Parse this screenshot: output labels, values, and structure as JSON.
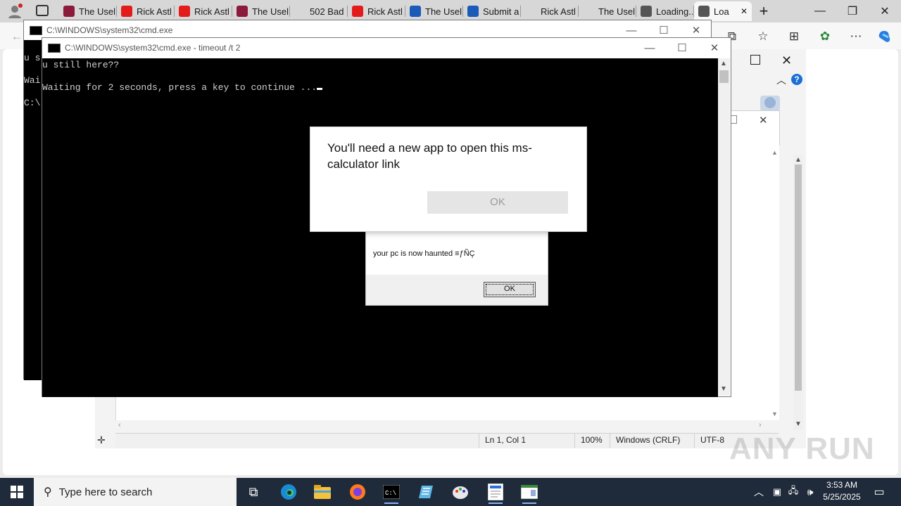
{
  "browser": {
    "tabs": [
      {
        "label": "The Usel",
        "fav": "#8b1a3b"
      },
      {
        "label": "Rick Astl",
        "fav": "#e41b1b"
      },
      {
        "label": "Rick Astl",
        "fav": "#e41b1b"
      },
      {
        "label": "The Usel",
        "fav": "#8b1a3b"
      },
      {
        "label": "502 Bad",
        "fav": "none"
      },
      {
        "label": "Rick Astl",
        "fav": "#e41b1b"
      },
      {
        "label": "The Usel",
        "fav": "#1a5ab8"
      },
      {
        "label": "Submit a",
        "fav": "#1a5ab8"
      },
      {
        "label": "Rick Astl",
        "fav": "none"
      },
      {
        "label": "The Usel",
        "fav": "none"
      },
      {
        "label": "Loading...",
        "fav": "#555555"
      },
      {
        "label": "Loa",
        "fav": "#555555"
      }
    ],
    "icons": {
      "profile": "profile-icon",
      "tab_actions": "tab-actions-icon",
      "new_tab": "+",
      "minimize": "—",
      "restore": "❐",
      "close": "✕"
    }
  },
  "cmd_back": {
    "title": "C:\\WINDOWS\\system32\\cmd.exe",
    "lines": [
      "u s",
      "",
      "Wai",
      "",
      "C:\\"
    ]
  },
  "cmd_front": {
    "title": "C:\\WINDOWS\\system32\\cmd.exe - timeout  /t 2",
    "line1": "u still here??",
    "line2": "Waiting for 2 seconds, press a key to continue ..."
  },
  "app_dialog": {
    "message": "You'll need a new app to open this ms-calculator link",
    "ok": "OK"
  },
  "haunt_dialog": {
    "message": "your pc is now haunted ≡ƒÑÇ",
    "ok": "OK"
  },
  "notepad": {
    "status": {
      "position": "Ln 1, Col 1",
      "zoom": "100%",
      "line_ending": "Windows (CRLF)",
      "encoding": "UTF-8"
    }
  },
  "watermark": "ANY RUN",
  "taskbar": {
    "search_placeholder": "Type here to search",
    "time": "3:53 AM",
    "date": "5/25/2025"
  }
}
